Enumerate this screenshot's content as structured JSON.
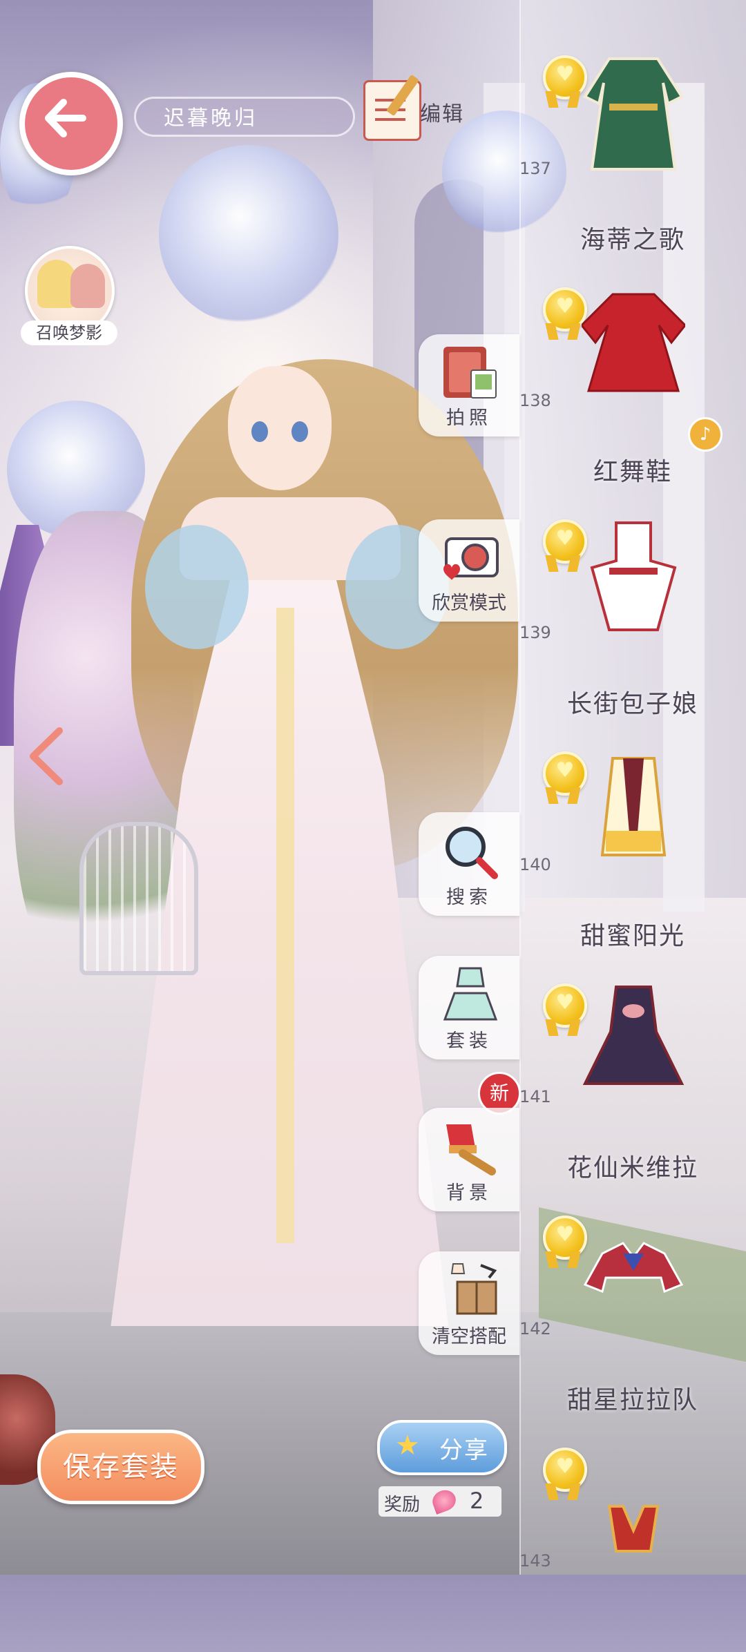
{
  "outfit_name": "迟暮晚归",
  "top": {
    "edit_label": "编辑"
  },
  "summon": {
    "label": "召唤梦影"
  },
  "side_buttons": {
    "photo": "拍照",
    "appreciate": "欣赏模式",
    "search": "搜索",
    "suits": "套装",
    "background": "背景",
    "clear": "清空搭配"
  },
  "new_badge": "新",
  "items": [
    {
      "num": "137",
      "name": "海蒂之歌",
      "color": "#2f6b4c"
    },
    {
      "num": "138",
      "name": "红舞鞋",
      "color": "#c6232d",
      "music": "♪"
    },
    {
      "num": "139",
      "name": "长街包子娘",
      "color": "#ffffff"
    },
    {
      "num": "140",
      "name": "甜蜜阳光",
      "color": "#f5c64a"
    },
    {
      "num": "141",
      "name": "花仙米维拉",
      "color": "#3a2d4d"
    },
    {
      "num": "142",
      "name": "甜星拉拉队",
      "color": "#b8303e"
    },
    {
      "num": "143",
      "name": "",
      "color": "#c0312a"
    }
  ],
  "bottom": {
    "save_label": "保存套装",
    "share_label": "分享",
    "reward_label": "奖励",
    "reward_count": "2"
  },
  "icons": {
    "back": "left-arrow-icon",
    "edit": "notepad-pencil-icon",
    "photo": "photo-album-icon",
    "appreciate": "camera-heart-icon",
    "search": "magnifier-icon",
    "suits": "dress-icon",
    "background": "paintbrush-icon",
    "clear": "box-clear-icon",
    "share": "star-hand-icon",
    "reward": "gem-icon"
  }
}
